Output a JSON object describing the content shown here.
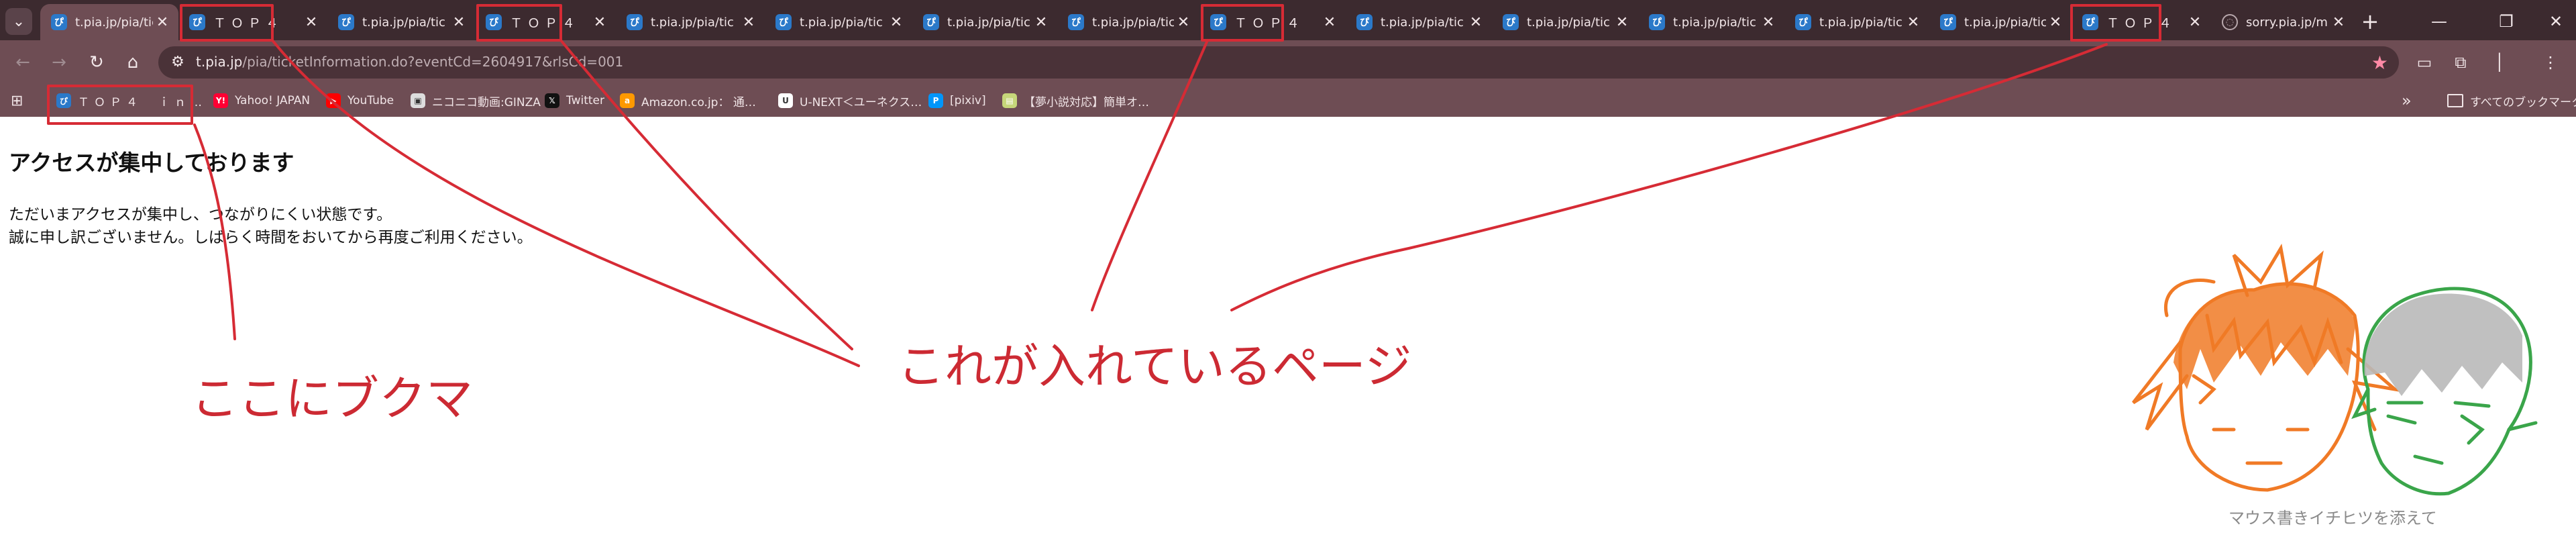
{
  "tabs": [
    {
      "title": "t.pia.jp/pia/tick",
      "favicon": "pia-icon",
      "active": true
    },
    {
      "title": "ＴＯＰ４",
      "favicon": "pia-icon",
      "active": false
    },
    {
      "title": "t.pia.jp/pia/tic",
      "favicon": "pia-icon",
      "active": false
    },
    {
      "title": "ＴＯＰ４",
      "favicon": "pia-icon",
      "active": false
    },
    {
      "title": "t.pia.jp/pia/tic",
      "favicon": "pia-icon",
      "active": false
    },
    {
      "title": "t.pia.jp/pia/tic",
      "favicon": "pia-icon",
      "active": false
    },
    {
      "title": "t.pia.jp/pia/tic",
      "favicon": "pia-icon",
      "active": false
    },
    {
      "title": "t.pia.jp/pia/tic",
      "favicon": "pia-icon",
      "active": false
    },
    {
      "title": "ＴＯＰ４",
      "favicon": "pia-icon",
      "active": false
    },
    {
      "title": "t.pia.jp/pia/tic",
      "favicon": "pia-icon",
      "active": false
    },
    {
      "title": "t.pia.jp/pia/tic",
      "favicon": "pia-icon",
      "active": false
    },
    {
      "title": "t.pia.jp/pia/tic",
      "favicon": "pia-icon",
      "active": false
    },
    {
      "title": "t.pia.jp/pia/tic",
      "favicon": "pia-icon",
      "active": false
    },
    {
      "title": "t.pia.jp/pia/tic",
      "favicon": "pia-icon",
      "active": false
    },
    {
      "title": "ＴＯＰ４",
      "favicon": "pia-icon",
      "active": false
    },
    {
      "title": "sorry.pia.jp/m",
      "favicon": "globe-icon",
      "active": false
    }
  ],
  "toolbar": {
    "url_host": "t.pia.jp",
    "url_path": "/pia/ticketInformation.do?eventCd=2604917&rlsCd=001"
  },
  "bookmarks": [
    {
      "label": "ＴＯＰ４　ｉｎ…",
      "icon": "pia-icon",
      "color": "#2b79c9"
    },
    {
      "label": "Yahoo! JAPAN",
      "icon": "yahoo-icon",
      "color": "#ff0033"
    },
    {
      "label": "YouTube",
      "icon": "youtube-icon",
      "color": "#ff0000"
    },
    {
      "label": "ニコニコ動画:GINZA",
      "icon": "niconico-icon",
      "color": "#dddddd"
    },
    {
      "label": "Twitter",
      "icon": "x-icon",
      "color": "#111111"
    },
    {
      "label": "Amazon.co.jp： 通…",
      "icon": "amazon-icon",
      "color": "#ff9900"
    },
    {
      "label": "U-NEXT＜ユーネクス…",
      "icon": "unext-icon",
      "color": "#ffffff"
    },
    {
      "label": "[pixiv]",
      "icon": "pixiv-icon",
      "color": "#0096fa"
    },
    {
      "label": "【夢小説対応】簡単オ…",
      "icon": "book-icon",
      "color": "#c6d77a"
    }
  ],
  "all_bookmarks_label": "すべてのブックマーク",
  "page": {
    "heading": "アクセスが集中しております",
    "line1": "ただいまアクセスが集中し、つながりにくい状態です。",
    "line2": "誠に申し訳ございません。しばらく時間をおいてから再度ご利用ください。"
  },
  "annotations": {
    "bookmark_note": "ここにブクマ",
    "page_note": "これが入れているページ",
    "caption": "マウス書きイチヒツを添えて"
  },
  "colors": {
    "tabstrip": "#3c2a2f",
    "toolbar": "#6e4d54",
    "annotation": "#cc2a33"
  }
}
